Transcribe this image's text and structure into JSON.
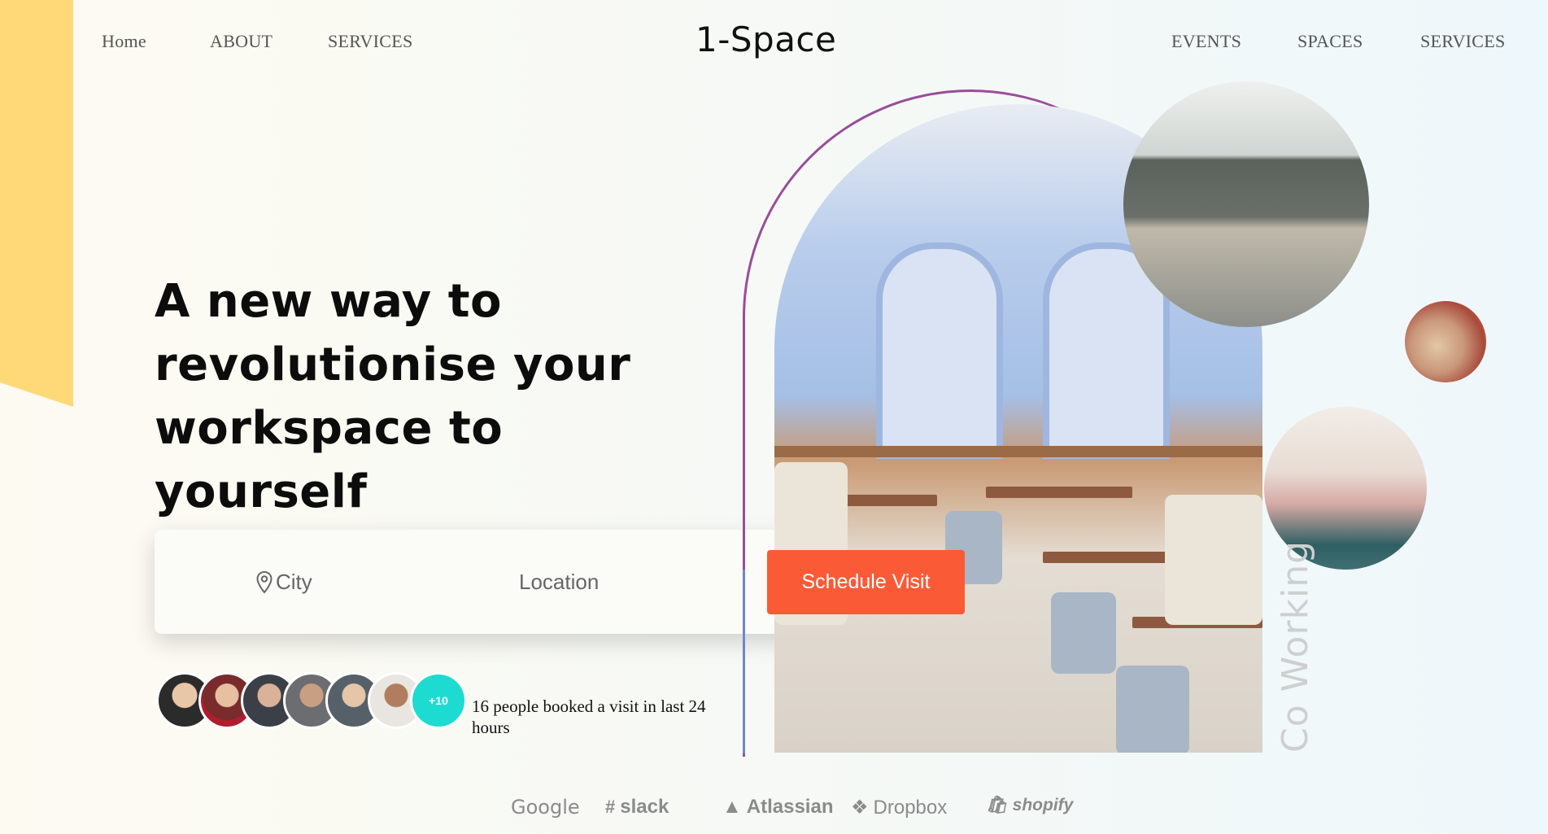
{
  "nav": {
    "left": [
      "Home",
      "ABOUT",
      "SERVICES"
    ],
    "logo": "1-Space",
    "right": [
      "EVENTS",
      "SPACES",
      "SERVICES"
    ]
  },
  "hero": {
    "headline_line1": "A new way to",
    "headline_line2": "revolutionise your",
    "headline_line3": "workspace to yourself"
  },
  "search": {
    "city_label": "City",
    "location_label": "Location",
    "button_label": "Schedule Visit"
  },
  "social_proof": {
    "more_count": "+10",
    "text": "16 people booked a visit in last 24 hours"
  },
  "side_label": "Co Working",
  "brands": [
    "Google",
    "slack",
    "Atlassian",
    "Dropbox",
    "shopify"
  ],
  "colors": {
    "accent": "#fb5a36",
    "yellow": "#ffd977",
    "teal": "#1ddbd0",
    "arch_outline": "#9b4c9b"
  }
}
